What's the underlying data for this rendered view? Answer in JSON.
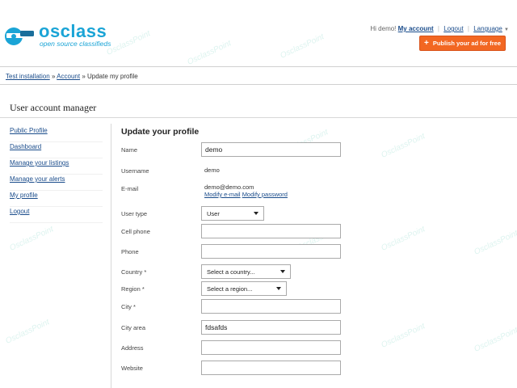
{
  "logo": {
    "word": "osclass",
    "tagline": "open source classifieds"
  },
  "topnav": {
    "greeting": "Hi demo!",
    "my_account": "My account",
    "logout": "Logout",
    "language": "Language"
  },
  "publish_button": {
    "label": "Publish your ad for free",
    "color": "#f26722"
  },
  "breadcrumb": {
    "item1": "Test installation",
    "sep": "»",
    "item2": "Account",
    "current": "Update my profile"
  },
  "page_title": "User account manager",
  "sidebar": {
    "items": [
      {
        "label": "Public Profile"
      },
      {
        "label": "Dashboard"
      },
      {
        "label": "Manage your listings"
      },
      {
        "label": "Manage your alerts"
      },
      {
        "label": "My profile"
      },
      {
        "label": "Logout"
      }
    ]
  },
  "form": {
    "title": "Update your profile",
    "name": {
      "label": "Name",
      "value": "demo"
    },
    "username": {
      "label": "Username",
      "value": "demo"
    },
    "email": {
      "label": "E-mail",
      "value": "demo@demo.com",
      "modify_email": "Modify e-mail",
      "modify_password": "Modify password"
    },
    "user_type": {
      "label": "User type",
      "selected": "User"
    },
    "cell_phone": {
      "label": "Cell phone",
      "value": ""
    },
    "phone": {
      "label": "Phone",
      "value": ""
    },
    "country": {
      "label": "Country *",
      "selected": "Select a country..."
    },
    "region": {
      "label": "Region *",
      "selected": "Select a region..."
    },
    "city": {
      "label": "City *",
      "value": ""
    },
    "city_area": {
      "label": "City area",
      "value": "fdsafds"
    },
    "address": {
      "label": "Address",
      "value": ""
    },
    "website": {
      "label": "Website",
      "value": ""
    }
  },
  "watermark": "OsclassPoint",
  "colors": {
    "link": "#1a4c8b",
    "brand": "#1aa4d6",
    "accent": "#f26722"
  }
}
